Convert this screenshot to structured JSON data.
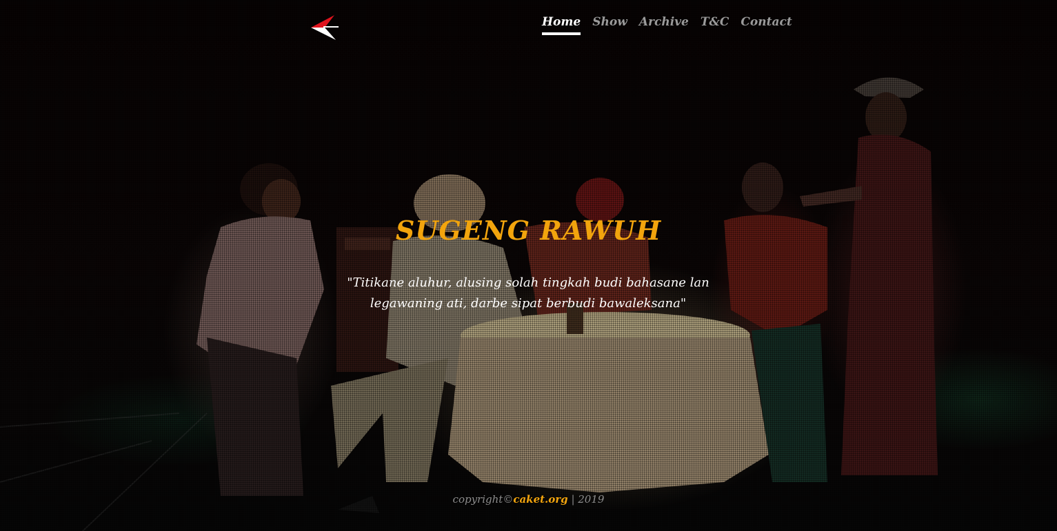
{
  "nav": {
    "items": [
      {
        "label": "Home",
        "active": true
      },
      {
        "label": "Show",
        "active": false
      },
      {
        "label": "Archive",
        "active": false
      },
      {
        "label": "T&C",
        "active": false
      },
      {
        "label": "Contact",
        "active": false
      }
    ]
  },
  "hero": {
    "title": "SUGENG RAWUH",
    "quote_line1": "\"Titikane aluhur, alusing solah tingkah budi bahasane lan",
    "quote_line2": "legawaning ati, darbe sipat berbudi bawaleksana\""
  },
  "footer": {
    "copyright_prefix": "copyright©",
    "brand": "caket.org",
    "separator": " | ",
    "year": "2019"
  },
  "colors": {
    "accent": "#f2a40d",
    "nav_active": "#ffffff",
    "nav_inactive": "#9a9a9a",
    "logo_red": "#e0141e"
  },
  "icons": {
    "logo": "arrow-logo-icon"
  }
}
